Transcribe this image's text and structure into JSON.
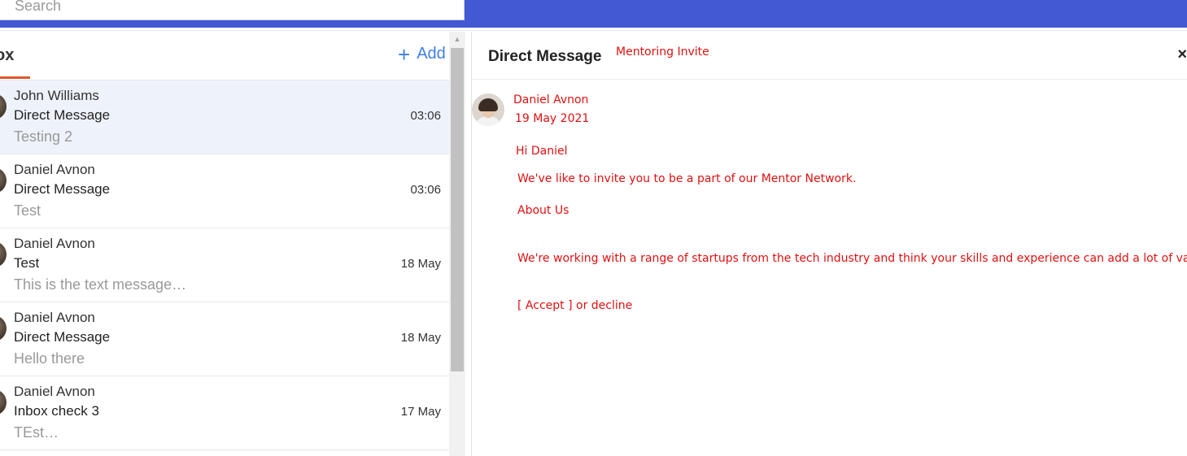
{
  "search": {
    "placeholder": "Search"
  },
  "inbox": {
    "tab_label": "ox",
    "add_label": "Add",
    "messages": [
      {
        "name": "John Williams",
        "subject": "Direct Message",
        "time": "03:06",
        "preview": "Testing 2"
      },
      {
        "name": "Daniel Avnon",
        "subject": "Direct Message",
        "time": "03:06",
        "preview": "Test"
      },
      {
        "name": "Daniel Avnon",
        "subject": "Test",
        "time": "18 May",
        "preview": "This is the text message…"
      },
      {
        "name": "Daniel Avnon",
        "subject": "Direct Message",
        "time": "18 May",
        "preview": "Hello there"
      },
      {
        "name": "Daniel Avnon",
        "subject": "Inbox check 3",
        "time": "17 May",
        "preview": "TEst…"
      }
    ]
  },
  "detail": {
    "title": "Direct Message",
    "overlay_title": "Mentoring Invite",
    "close_glyph": "×",
    "sender_name": "Daniel Avnon",
    "sender_date": "19 May 2021",
    "greeting": "Hi Daniel",
    "line1": "We've like to invite you to be a part of our Mentor Network.",
    "about": "About Us",
    "body2": "We're working with a range of startups from the tech industry and think your skills and experience can add a lot of value.",
    "accept_text": "[ Accept  ]",
    "decline_text": " or decline"
  },
  "colors": {
    "topbar": "#4359d3",
    "accent_blue": "#3f7ee8",
    "tab_underline": "#e0582b",
    "overlay_red": "#e01010",
    "selected_row": "#eef2fb"
  }
}
